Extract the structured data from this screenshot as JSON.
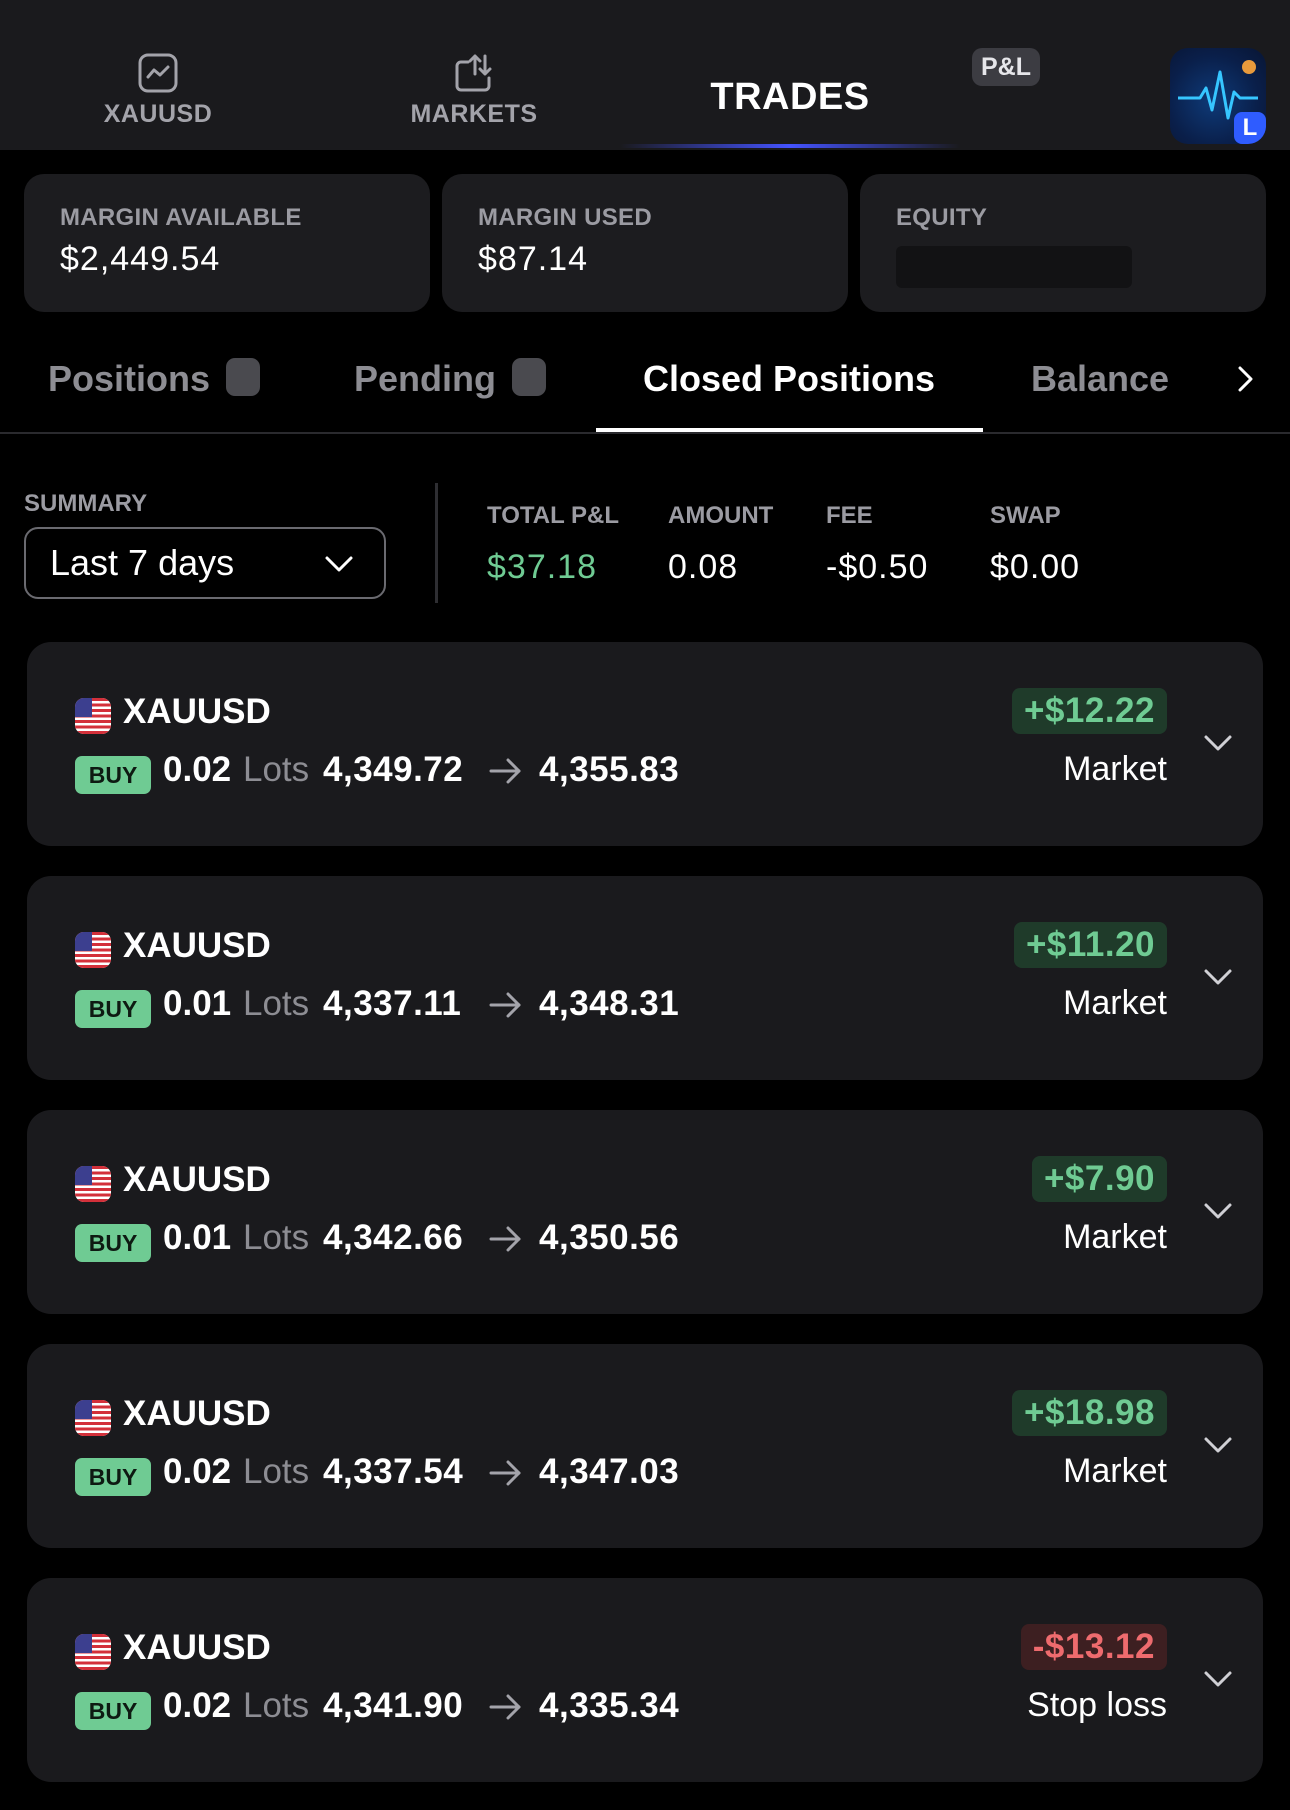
{
  "topnav": {
    "tabs": [
      {
        "label": "XAUUSD",
        "icon": "chart-line-icon"
      },
      {
        "label": "MARKETS",
        "icon": "transfer-arrows-icon"
      },
      {
        "label": "TRADES"
      }
    ],
    "pnl_badge": "P&L",
    "app_avatar_badge": "L"
  },
  "margins": {
    "available": {
      "label": "MARGIN AVAILABLE",
      "value": "$2,449.54"
    },
    "used": {
      "label": "MARGIN USED",
      "value": "$87.14"
    },
    "equity": {
      "label": "EQUITY"
    }
  },
  "subtabs": {
    "positions": "Positions",
    "pending": "Pending",
    "closed": "Closed Positions",
    "balance": "Balance"
  },
  "summary": {
    "label": "SUMMARY",
    "period": "Last 7 days",
    "stats": [
      {
        "label": "TOTAL P&L",
        "value": "$37.18"
      },
      {
        "label": "AMOUNT",
        "value": "0.08"
      },
      {
        "label": "FEE",
        "value": "-$0.50"
      },
      {
        "label": "SWAP",
        "value": "$0.00"
      }
    ]
  },
  "trades": [
    {
      "symbol": "XAUUSD",
      "side": "BUY",
      "lots": "0.02",
      "lots_label": "Lots",
      "open": "4,349.72",
      "close": "4,355.83",
      "pnl": "+$12.22",
      "type": "Market"
    },
    {
      "symbol": "XAUUSD",
      "side": "BUY",
      "lots": "0.01",
      "lots_label": "Lots",
      "open": "4,337.11",
      "close": "4,348.31",
      "pnl": "+$11.20",
      "type": "Market"
    },
    {
      "symbol": "XAUUSD",
      "side": "BUY",
      "lots": "0.01",
      "lots_label": "Lots",
      "open": "4,342.66",
      "close": "4,350.56",
      "pnl": "+$7.90",
      "type": "Market"
    },
    {
      "symbol": "XAUUSD",
      "side": "BUY",
      "lots": "0.02",
      "lots_label": "Lots",
      "open": "4,337.54",
      "close": "4,347.03",
      "pnl": "+$18.98",
      "type": "Market"
    },
    {
      "symbol": "XAUUSD",
      "side": "BUY",
      "lots": "0.02",
      "lots_label": "Lots",
      "open": "4,341.90",
      "close": "4,335.34",
      "pnl": "-$13.12",
      "type": "Stop loss"
    }
  ],
  "colors": {
    "background": "#000000",
    "card": "#1a1a1d",
    "profit": "#6fcb93",
    "loss": "#ee6b6e",
    "accent": "#4453ff"
  }
}
